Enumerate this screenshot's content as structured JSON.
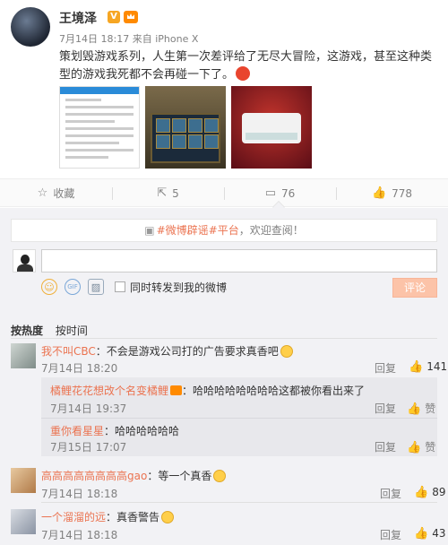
{
  "post": {
    "username": "王境泽",
    "verified_badge": "V",
    "time": "7月14日 18:17",
    "source_prefix": "来自",
    "source": "iPhone X",
    "text": "策划毁游戏系列，人生第一次差评给了无尽大冒险，这游戏，甚至这种类型的游戏我死都不会再碰一下了。",
    "images": [
      "app-screenshot",
      "game-screenshot",
      "dialog-screenshot"
    ]
  },
  "actions": {
    "favorite": {
      "icon": "star-icon",
      "label": "收藏"
    },
    "repost": {
      "icon": "repost-icon",
      "label": "5"
    },
    "comment": {
      "icon": "comment-icon",
      "label": "76"
    },
    "like": {
      "icon": "thumbs-up-icon",
      "label": "778"
    }
  },
  "comment_panel": {
    "notice_prefix": "#微博辟谣#平台",
    "notice_suffix": "，欢迎查阅！",
    "input_value": "",
    "forward_label": "同时转发到我的微博",
    "submit_label": "评论",
    "sort_hot": "按热度",
    "sort_time": "按时间"
  },
  "comments": [
    {
      "name": "我不叫CBC",
      "text": "：不会是游戏公司打的广告要求真香吧",
      "time": "7月14日 18:20",
      "reply": "回复",
      "likes": "141",
      "hot": false
    },
    {
      "name": "高高高高高高高高gao",
      "text": "：等一个真香",
      "time": "7月14日 18:18",
      "reply": "回复",
      "likes": "89",
      "hot": true
    },
    {
      "name": "一个溜溜的远",
      "text": "：真香警告",
      "time": "7月14日 18:18",
      "reply": "回复",
      "likes": "43",
      "hot": true
    }
  ],
  "replies": [
    {
      "name": "橘鲤花花想改个名变橘鲤",
      "text": "：哈哈哈哈哈哈哈哈这都被你看出来了",
      "time": "7月14日 19:37",
      "reply": "回复",
      "like": "赞"
    },
    {
      "name": "重你看星星",
      "text": "：哈哈哈哈哈哈",
      "time": "7月15日 17:07",
      "reply": "回复",
      "like": "赞"
    }
  ]
}
